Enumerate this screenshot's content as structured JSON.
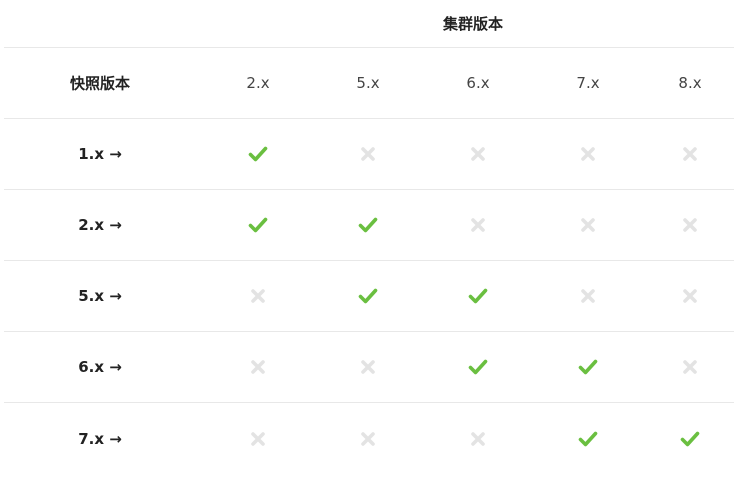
{
  "title": "集群版本",
  "header": {
    "row_label": "快照版本",
    "columns": [
      "2.x",
      "5.x",
      "6.x",
      "7.x",
      "8.x"
    ]
  },
  "rows": [
    {
      "label": "1.x →",
      "compat": [
        true,
        false,
        false,
        false,
        false
      ]
    },
    {
      "label": "2.x →",
      "compat": [
        true,
        true,
        false,
        false,
        false
      ]
    },
    {
      "label": "5.x →",
      "compat": [
        false,
        true,
        true,
        false,
        false
      ]
    },
    {
      "label": "6.x →",
      "compat": [
        false,
        false,
        true,
        true,
        false
      ]
    },
    {
      "label": "7.x →",
      "compat": [
        false,
        false,
        false,
        true,
        true
      ]
    }
  ],
  "colors": {
    "check": "#6abf40",
    "cross": "#e3e3e3"
  },
  "icons": {
    "compatible": "check-icon",
    "incompatible": "cross-icon"
  }
}
